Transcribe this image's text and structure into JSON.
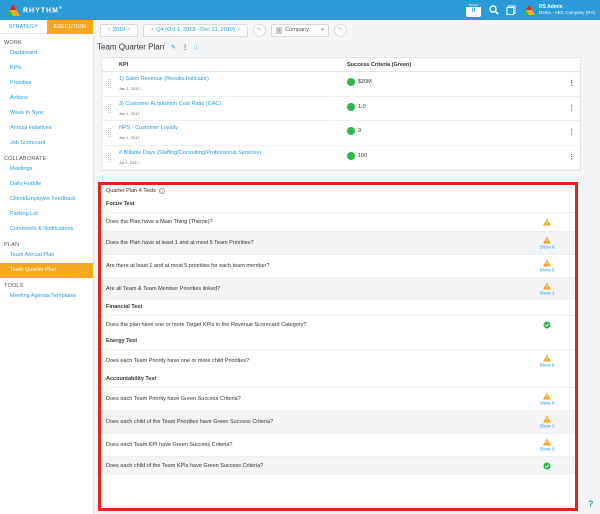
{
  "app": {
    "brand": "RHYTHM",
    "brand_mark": "®"
  },
  "topbar": {
    "calendar_month": "TODAY",
    "calendar_day": "6",
    "user_name": "RS Admin",
    "company": "Demo - ABC Company (RA)"
  },
  "sidebar": {
    "tab_strategy": "STRATEGY",
    "tab_execution": "EXECUTION",
    "sections": [
      {
        "title": "WORK",
        "items": [
          "Dashboard",
          "KPIs",
          "Priorities",
          "Actions",
          "Week In Sync",
          "Annual Initiatives",
          "Job Scorecard"
        ]
      },
      {
        "title": "COLLABORATE",
        "items": [
          "Meetings",
          "Daily Huddle",
          "Client/Employee Feedback",
          "Parking Lot",
          "Comments & Notifications"
        ]
      },
      {
        "title": "PLAN",
        "items": [
          "Team Annual Plan",
          "Team Quarter Plan"
        ]
      },
      {
        "title": "TOOLS",
        "items": [
          "Meeting Agenda Templates"
        ]
      }
    ],
    "active_item": "Team Quarter Plan"
  },
  "toolbar": {
    "year": "2019",
    "quarter": "Q4 (Oct 1, 2019 - Dec 31, 2019)",
    "scope_badge": "T",
    "scope": "Company"
  },
  "page": {
    "title": "Team Quarter Plan",
    "title_sup": "i"
  },
  "kpi_table": {
    "col_kpi": "KPI",
    "col_success": "Success Criteria (Green)",
    "rows": [
      {
        "name": "1) Sales Revenue (Results Indicator)",
        "date": "Jan 1, 2017 -",
        "value": "$20M"
      },
      {
        "name": "3) Customer Acquisition Cost Ratio (CAC)",
        "date": "Jan 1, 2017 -",
        "value": "1.0"
      },
      {
        "name": "NPS - Customer Loyalty",
        "date": "Jan 1, 2017 -",
        "value": "9"
      },
      {
        "name": "# Billable Days (Staffing/Consulting/Professional Services)",
        "date": "Jul 1, 2017 -",
        "value": "100"
      }
    ]
  },
  "tests": {
    "title": "Quarter Plan 4 Tests",
    "colors": {
      "warn": "#f7a823",
      "pass": "#2db84d"
    },
    "sections": [
      {
        "title": "Focus Test",
        "rows": [
          {
            "q": "Does the Plan have a Main Thing (Theme)?",
            "status": "warn",
            "show": ""
          },
          {
            "q": "Does the Plan have at least 1 and at most 5 Team Priorities?",
            "status": "warn",
            "show": "Show 6"
          },
          {
            "q": "Are there at least 1 and at most 5 priorities for each team member?",
            "status": "warn",
            "show": "Show 5"
          },
          {
            "q": "Are all Team & Team Member Priorities linked?",
            "status": "warn",
            "show": "Show 1"
          }
        ]
      },
      {
        "title": "Financial Test",
        "rows": [
          {
            "q": "Does the plan have one or more Target KPIs in the Revenue Scorecard Category?",
            "status": "pass",
            "show": ""
          }
        ]
      },
      {
        "title": "Energy Test",
        "rows": [
          {
            "q": "Does each Team Priority have one or more child Priorities?",
            "status": "warn",
            "show": "Show 6"
          }
        ]
      },
      {
        "title": "Accountability Test",
        "rows": [
          {
            "q": "Does each Team Priority have Green Success Criteria?",
            "status": "warn",
            "show": "Show 6"
          },
          {
            "q": "Does each child of the Team Priorities have Green Success Criteria?",
            "status": "warn",
            "show": "Show 2"
          },
          {
            "q": "Does each Team KPI have Green Success Criteria?",
            "status": "warn",
            "show": "Show 8"
          },
          {
            "q": "Does each child of the Team KPIs have Green Success Criteria?",
            "status": "pass",
            "show": ""
          }
        ]
      }
    ]
  },
  "help_label": "?"
}
